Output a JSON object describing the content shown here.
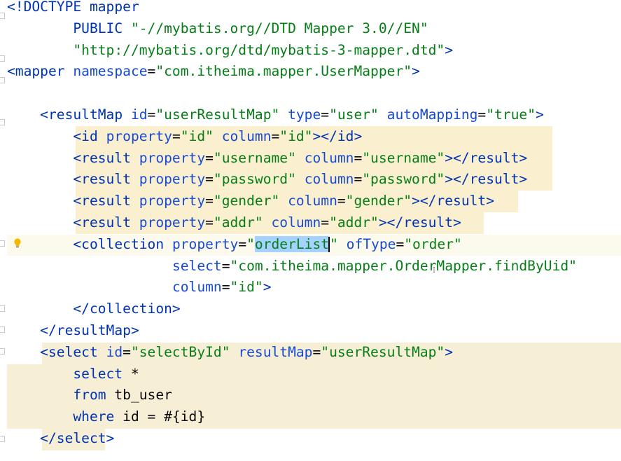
{
  "editor": {
    "lines": [
      [
        {
          "t": "<!",
          "c": "tag"
        },
        {
          "t": "DOCTYPE mapper",
          "c": "tag"
        }
      ],
      [
        {
          "t": "        PUBLIC ",
          "c": "tag"
        },
        {
          "t": "\"-//mybatis.org//DTD Mapper 3.0//EN\"",
          "c": "str"
        }
      ],
      [
        {
          "t": "        ",
          "c": "plain"
        },
        {
          "t": "\"http://mybatis.org/dtd/mybatis-3-mapper.dtd\"",
          "c": "str"
        },
        {
          "t": ">",
          "c": "tag"
        }
      ],
      [
        {
          "t": "<mapper ",
          "c": "tag"
        },
        {
          "t": "namespace",
          "c": "attr"
        },
        {
          "t": "=",
          "c": "plain"
        },
        {
          "t": "\"com.itheima.mapper.UserMapper\"",
          "c": "str"
        },
        {
          "t": ">",
          "c": "tag"
        }
      ],
      [],
      [
        {
          "t": "    <resultMap ",
          "c": "tag"
        },
        {
          "t": "id",
          "c": "attr"
        },
        {
          "t": "=",
          "c": "plain"
        },
        {
          "t": "\"userResultMap\" ",
          "c": "str"
        },
        {
          "t": "type",
          "c": "attr"
        },
        {
          "t": "=",
          "c": "plain"
        },
        {
          "t": "\"user\" ",
          "c": "str"
        },
        {
          "t": "autoMapping",
          "c": "attr"
        },
        {
          "t": "=",
          "c": "plain"
        },
        {
          "t": "\"true\"",
          "c": "str"
        },
        {
          "t": ">",
          "c": "tag"
        }
      ],
      [
        {
          "t": "        <id ",
          "c": "tag"
        },
        {
          "t": "property",
          "c": "attr"
        },
        {
          "t": "=",
          "c": "plain"
        },
        {
          "t": "\"id\" ",
          "c": "str"
        },
        {
          "t": "column",
          "c": "attr"
        },
        {
          "t": "=",
          "c": "plain"
        },
        {
          "t": "\"id\"",
          "c": "str"
        },
        {
          "t": "></id>",
          "c": "tag"
        }
      ],
      [
        {
          "t": "        <result ",
          "c": "tag"
        },
        {
          "t": "property",
          "c": "attr"
        },
        {
          "t": "=",
          "c": "plain"
        },
        {
          "t": "\"username\" ",
          "c": "str"
        },
        {
          "t": "column",
          "c": "attr"
        },
        {
          "t": "=",
          "c": "plain"
        },
        {
          "t": "\"username\"",
          "c": "str"
        },
        {
          "t": "></result>",
          "c": "tag"
        }
      ],
      [
        {
          "t": "        <result ",
          "c": "tag"
        },
        {
          "t": "property",
          "c": "attr"
        },
        {
          "t": "=",
          "c": "plain"
        },
        {
          "t": "\"password\" ",
          "c": "str"
        },
        {
          "t": "column",
          "c": "attr"
        },
        {
          "t": "=",
          "c": "plain"
        },
        {
          "t": "\"password\"",
          "c": "str"
        },
        {
          "t": "></result>",
          "c": "tag"
        }
      ],
      [
        {
          "t": "        <result ",
          "c": "tag"
        },
        {
          "t": "property",
          "c": "attr"
        },
        {
          "t": "=",
          "c": "plain"
        },
        {
          "t": "\"gender\" ",
          "c": "str"
        },
        {
          "t": "column",
          "c": "attr"
        },
        {
          "t": "=",
          "c": "plain"
        },
        {
          "t": "\"gender\"",
          "c": "str"
        },
        {
          "t": "></result>",
          "c": "tag"
        }
      ],
      [
        {
          "t": "        <result ",
          "c": "tag"
        },
        {
          "t": "property",
          "c": "attr"
        },
        {
          "t": "=",
          "c": "plain"
        },
        {
          "t": "\"addr\" ",
          "c": "str"
        },
        {
          "t": "column",
          "c": "attr"
        },
        {
          "t": "=",
          "c": "plain"
        },
        {
          "t": "\"addr\"",
          "c": "str"
        },
        {
          "t": "></result>",
          "c": "tag"
        }
      ],
      [
        {
          "t": "        <collection ",
          "c": "tag"
        },
        {
          "t": "property",
          "c": "attr"
        },
        {
          "t": "=",
          "c": "plain"
        },
        {
          "t": "\"",
          "c": "str"
        },
        {
          "t": "orderList",
          "c": "str-sel"
        },
        {
          "t": "caret",
          "c": "caret"
        },
        {
          "t": "\" ",
          "c": "str"
        },
        {
          "t": "ofType",
          "c": "attr"
        },
        {
          "t": "=",
          "c": "plain"
        },
        {
          "t": "\"order\"",
          "c": "str"
        }
      ],
      [
        {
          "t": "                    ",
          "c": "plain"
        },
        {
          "t": "select",
          "c": "attr"
        },
        {
          "t": "=",
          "c": "plain"
        },
        {
          "t": "\"com.itheima.mapper.OrderMapper.findByUid\"",
          "c": "str"
        }
      ],
      [
        {
          "t": "                    ",
          "c": "plain"
        },
        {
          "t": "column",
          "c": "attr"
        },
        {
          "t": "=",
          "c": "plain"
        },
        {
          "t": "\"id\"",
          "c": "str"
        },
        {
          "t": ">",
          "c": "tag"
        }
      ],
      [
        {
          "t": "        </collection>",
          "c": "tag"
        }
      ],
      [
        {
          "t": "    </resultMap>",
          "c": "tag"
        }
      ],
      [
        {
          "t": "    <select ",
          "c": "tag"
        },
        {
          "t": "id",
          "c": "attr"
        },
        {
          "t": "=",
          "c": "plain"
        },
        {
          "t": "\"selectById\" ",
          "c": "str"
        },
        {
          "t": "resultMap",
          "c": "attr"
        },
        {
          "t": "=",
          "c": "plain"
        },
        {
          "t": "\"userResultMap\"",
          "c": "str"
        },
        {
          "t": ">",
          "c": "tag"
        }
      ],
      [
        {
          "t": "        select ",
          "c": "kw"
        },
        {
          "t": "*",
          "c": "plain"
        }
      ],
      [
        {
          "t": "        from ",
          "c": "kw"
        },
        {
          "t": "tb_user",
          "c": "plain"
        }
      ],
      [
        {
          "t": "        where ",
          "c": "kw"
        },
        {
          "t": "id = #{id}",
          "c": "plain"
        }
      ],
      [
        {
          "t": "    </select>",
          "c": "tag"
        }
      ]
    ]
  },
  "icons": {
    "intention_bulb": "lightbulb-icon",
    "text_cursor": "ibeam-cursor-icon"
  },
  "colors": {
    "tag": "#0033b3",
    "attr": "#174ad4",
    "string": "#067d17",
    "plain": "#080808",
    "highlight": "#faf0cf",
    "selection": "#a6d2ff",
    "bulb": "#f5b800"
  }
}
